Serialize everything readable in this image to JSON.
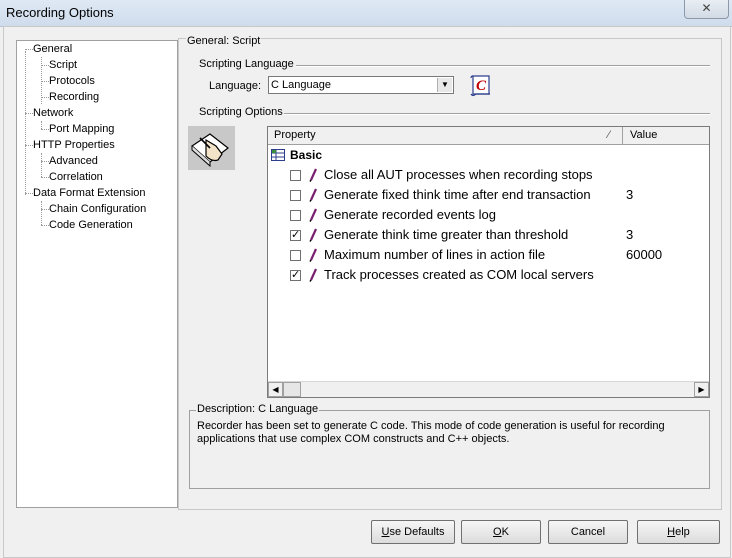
{
  "window": {
    "title": "Recording Options",
    "close_glyph": "✕"
  },
  "tree": {
    "items": [
      {
        "label": "General",
        "level": 0
      },
      {
        "label": "Script",
        "level": 1
      },
      {
        "label": "Protocols",
        "level": 1
      },
      {
        "label": "Recording",
        "level": 1
      },
      {
        "label": "Network",
        "level": 0
      },
      {
        "label": "Port Mapping",
        "level": 1
      },
      {
        "label": "HTTP Properties",
        "level": 0
      },
      {
        "label": "Advanced",
        "level": 1
      },
      {
        "label": "Correlation",
        "level": 1
      },
      {
        "label": "Data Format Extension",
        "level": 0
      },
      {
        "label": "Chain Configuration",
        "level": 1
      },
      {
        "label": "Code Generation",
        "level": 1
      }
    ]
  },
  "panel": {
    "header": "General: Script",
    "scripting_language_group": "Scripting Language",
    "language_label": "Language:",
    "language_value": "C Language",
    "scripting_options_group": "Scripting Options"
  },
  "grid": {
    "col_property": "Property",
    "col_value": "Value",
    "sort_glyph": "⁄",
    "category": "Basic",
    "rows": [
      {
        "label": "Close all AUT processes when recording stops",
        "checked": false,
        "value": ""
      },
      {
        "label": "Generate fixed think time after end transaction",
        "checked": false,
        "value": "3"
      },
      {
        "label": "Generate recorded events log",
        "checked": false,
        "value": ""
      },
      {
        "label": "Generate think time greater than threshold",
        "checked": true,
        "value": "3"
      },
      {
        "label": "Maximum number of lines in action file",
        "checked": false,
        "value": "60000"
      },
      {
        "label": "Track processes created as COM local servers",
        "checked": true,
        "value": ""
      }
    ]
  },
  "description": {
    "title": "Description: C Language",
    "text": "Recorder has been set to generate C code.  This mode of code generation is useful for recording applications that use complex COM constructs and C++ objects."
  },
  "buttons": {
    "use_defaults_u": "U",
    "use_defaults_rest": "se Defaults",
    "ok_u": "O",
    "ok_rest": "K",
    "cancel": "Cancel",
    "help_u": "H",
    "help_rest": "elp"
  },
  "icons": {
    "script_icon": "c-script-icon",
    "hand_icon": "writing-hand-icon",
    "pen_icon": "pencil-icon",
    "category_icon": "grid-icon"
  },
  "colors": {
    "accent": "#c00000",
    "pen": "#7a1f6e"
  }
}
